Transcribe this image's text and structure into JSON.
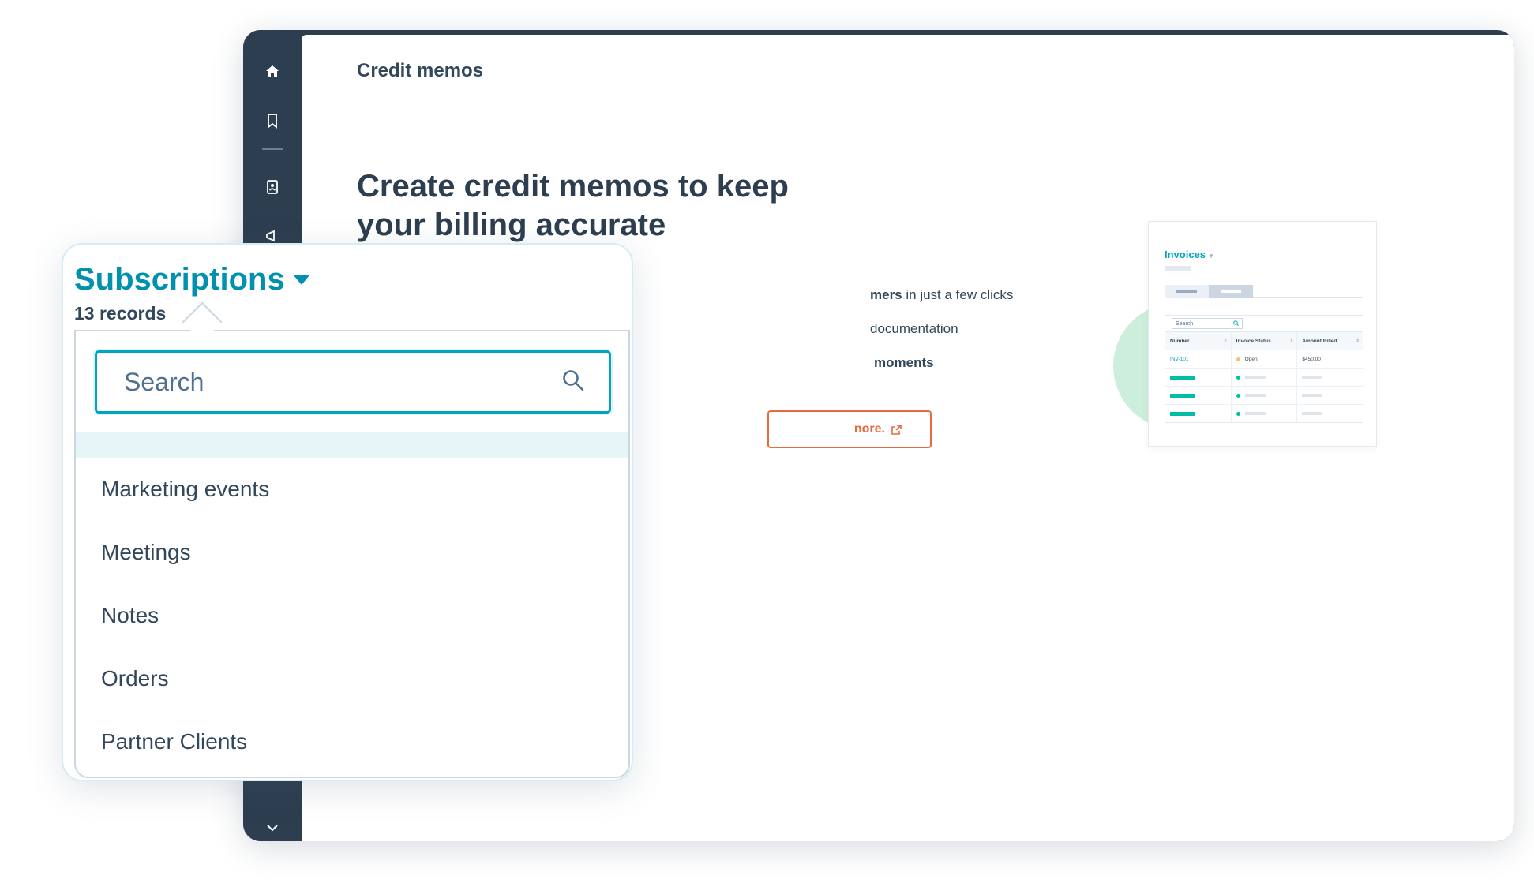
{
  "window": {
    "page_title": "Credit memos",
    "hero_heading": "Create credit memos to keep your billing accurate",
    "features": [
      {
        "bold": "mers",
        "text": " in just a few clicks"
      },
      {
        "bold": "",
        "text": " documentation"
      },
      {
        "bold": "moments",
        "text": ""
      }
    ],
    "learn_more_label": "nore."
  },
  "invoices_card": {
    "title": "Invoices",
    "search_placeholder": "Search",
    "columns": [
      "Number",
      "Invoice Status",
      "Amount Billed"
    ],
    "first_row": {
      "number": "INV-101",
      "status": "Open",
      "amount": "$450.00"
    }
  },
  "dropdown": {
    "title": "Subscriptions",
    "record_count": "13 records",
    "search_placeholder": "Search",
    "items": [
      "Marketing events",
      "Meetings",
      "Notes",
      "Orders",
      "Partner Clients"
    ]
  },
  "colors": {
    "nav": "#2d3e50",
    "accent_teal": "#00a4bd",
    "title_teal": "#0091ae",
    "accent_orange": "#e86b3e",
    "text_dark": "#33475b"
  },
  "icons": {
    "nav_top": [
      "home-icon",
      "bookmark-icon",
      "contacts-icon",
      "megaphone-icon"
    ],
    "nav_bottom": "chevron-down-icon"
  }
}
